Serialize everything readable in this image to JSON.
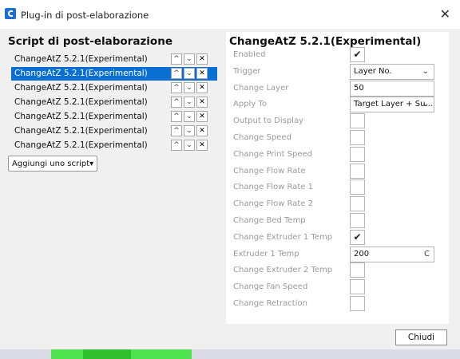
{
  "window": {
    "title": "Plug-in di post-elaborazione",
    "close_symbol": "✕"
  },
  "left": {
    "heading": "Script di post-elaborazione",
    "scripts": [
      "ChangeAtZ 5.2.1(Experimental)",
      "ChangeAtZ 5.2.1(Experimental)",
      "ChangeAtZ 5.2.1(Experimental)",
      "ChangeAtZ 5.2.1(Experimental)",
      "ChangeAtZ 5.2.1(Experimental)",
      "ChangeAtZ 5.2.1(Experimental)",
      "ChangeAtZ 5.2.1(Experimental)"
    ],
    "selected_index": 1,
    "up_symbol": "^",
    "down_symbol": "⌄",
    "remove_symbol": "✕",
    "add_button": "Aggiungi uno script▾"
  },
  "right": {
    "heading": "ChangeAtZ 5.2.1(Experimental)",
    "settings": [
      {
        "label": "Enabled",
        "type": "check",
        "checked": true
      },
      {
        "label": "Trigger",
        "type": "select",
        "value": "Layer No."
      },
      {
        "label": "Change Layer",
        "type": "text",
        "value": "50"
      },
      {
        "label": "Apply To",
        "type": "select",
        "value": "Target Layer + Su..."
      },
      {
        "label": "Output to Display",
        "type": "check",
        "checked": false
      },
      {
        "label": "Change Speed",
        "type": "check",
        "checked": false
      },
      {
        "label": "Change Print Speed",
        "type": "check",
        "checked": false
      },
      {
        "label": "Change Flow Rate",
        "type": "check",
        "checked": false
      },
      {
        "label": "Change Flow Rate 1",
        "type": "check",
        "checked": false
      },
      {
        "label": "Change Flow Rate 2",
        "type": "check",
        "checked": false
      },
      {
        "label": "Change Bed Temp",
        "type": "check",
        "checked": false
      },
      {
        "label": "Change Extruder 1 Temp",
        "type": "check",
        "checked": true
      },
      {
        "label": "Extruder 1 Temp",
        "type": "text",
        "value": "200",
        "unit": "C"
      },
      {
        "label": "Change Extruder 2 Temp",
        "type": "check",
        "checked": false
      },
      {
        "label": "Change Fan Speed",
        "type": "check",
        "checked": false
      },
      {
        "label": "Change Retraction",
        "type": "check",
        "checked": false
      }
    ],
    "check_symbol": "✔",
    "chevron_symbol": "⌄"
  },
  "footer": {
    "close_button": "Chiudi"
  },
  "colors": {
    "selection": "#0a6fd3",
    "viewport_green": "#4ee24e"
  }
}
